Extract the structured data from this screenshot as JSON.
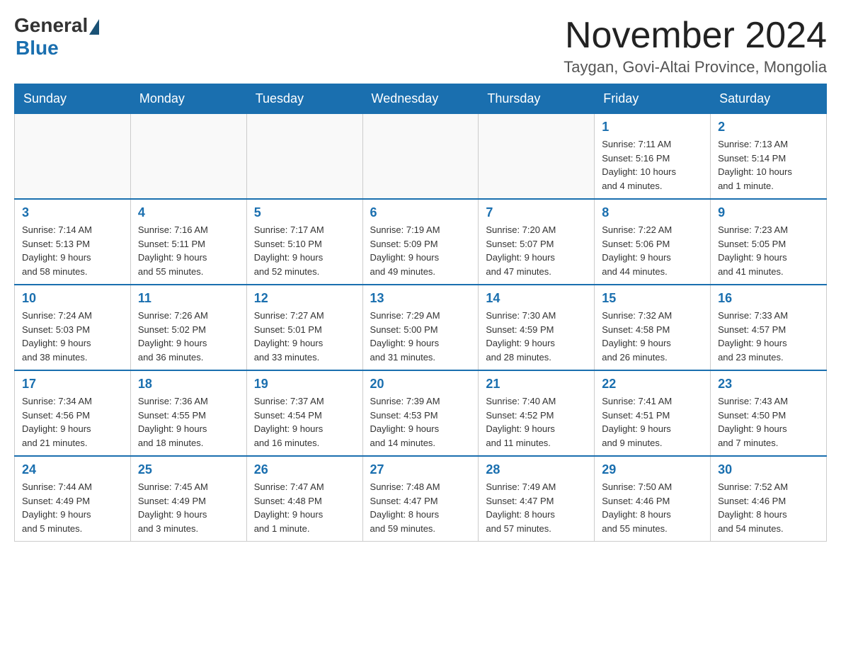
{
  "header": {
    "logo_general": "General",
    "logo_blue": "Blue",
    "month_title": "November 2024",
    "location": "Taygan, Govi-Altai Province, Mongolia"
  },
  "weekdays": [
    "Sunday",
    "Monday",
    "Tuesday",
    "Wednesday",
    "Thursday",
    "Friday",
    "Saturday"
  ],
  "weeks": [
    [
      {
        "day": "",
        "info": ""
      },
      {
        "day": "",
        "info": ""
      },
      {
        "day": "",
        "info": ""
      },
      {
        "day": "",
        "info": ""
      },
      {
        "day": "",
        "info": ""
      },
      {
        "day": "1",
        "info": "Sunrise: 7:11 AM\nSunset: 5:16 PM\nDaylight: 10 hours\nand 4 minutes."
      },
      {
        "day": "2",
        "info": "Sunrise: 7:13 AM\nSunset: 5:14 PM\nDaylight: 10 hours\nand 1 minute."
      }
    ],
    [
      {
        "day": "3",
        "info": "Sunrise: 7:14 AM\nSunset: 5:13 PM\nDaylight: 9 hours\nand 58 minutes."
      },
      {
        "day": "4",
        "info": "Sunrise: 7:16 AM\nSunset: 5:11 PM\nDaylight: 9 hours\nand 55 minutes."
      },
      {
        "day": "5",
        "info": "Sunrise: 7:17 AM\nSunset: 5:10 PM\nDaylight: 9 hours\nand 52 minutes."
      },
      {
        "day": "6",
        "info": "Sunrise: 7:19 AM\nSunset: 5:09 PM\nDaylight: 9 hours\nand 49 minutes."
      },
      {
        "day": "7",
        "info": "Sunrise: 7:20 AM\nSunset: 5:07 PM\nDaylight: 9 hours\nand 47 minutes."
      },
      {
        "day": "8",
        "info": "Sunrise: 7:22 AM\nSunset: 5:06 PM\nDaylight: 9 hours\nand 44 minutes."
      },
      {
        "day": "9",
        "info": "Sunrise: 7:23 AM\nSunset: 5:05 PM\nDaylight: 9 hours\nand 41 minutes."
      }
    ],
    [
      {
        "day": "10",
        "info": "Sunrise: 7:24 AM\nSunset: 5:03 PM\nDaylight: 9 hours\nand 38 minutes."
      },
      {
        "day": "11",
        "info": "Sunrise: 7:26 AM\nSunset: 5:02 PM\nDaylight: 9 hours\nand 36 minutes."
      },
      {
        "day": "12",
        "info": "Sunrise: 7:27 AM\nSunset: 5:01 PM\nDaylight: 9 hours\nand 33 minutes."
      },
      {
        "day": "13",
        "info": "Sunrise: 7:29 AM\nSunset: 5:00 PM\nDaylight: 9 hours\nand 31 minutes."
      },
      {
        "day": "14",
        "info": "Sunrise: 7:30 AM\nSunset: 4:59 PM\nDaylight: 9 hours\nand 28 minutes."
      },
      {
        "day": "15",
        "info": "Sunrise: 7:32 AM\nSunset: 4:58 PM\nDaylight: 9 hours\nand 26 minutes."
      },
      {
        "day": "16",
        "info": "Sunrise: 7:33 AM\nSunset: 4:57 PM\nDaylight: 9 hours\nand 23 minutes."
      }
    ],
    [
      {
        "day": "17",
        "info": "Sunrise: 7:34 AM\nSunset: 4:56 PM\nDaylight: 9 hours\nand 21 minutes."
      },
      {
        "day": "18",
        "info": "Sunrise: 7:36 AM\nSunset: 4:55 PM\nDaylight: 9 hours\nand 18 minutes."
      },
      {
        "day": "19",
        "info": "Sunrise: 7:37 AM\nSunset: 4:54 PM\nDaylight: 9 hours\nand 16 minutes."
      },
      {
        "day": "20",
        "info": "Sunrise: 7:39 AM\nSunset: 4:53 PM\nDaylight: 9 hours\nand 14 minutes."
      },
      {
        "day": "21",
        "info": "Sunrise: 7:40 AM\nSunset: 4:52 PM\nDaylight: 9 hours\nand 11 minutes."
      },
      {
        "day": "22",
        "info": "Sunrise: 7:41 AM\nSunset: 4:51 PM\nDaylight: 9 hours\nand 9 minutes."
      },
      {
        "day": "23",
        "info": "Sunrise: 7:43 AM\nSunset: 4:50 PM\nDaylight: 9 hours\nand 7 minutes."
      }
    ],
    [
      {
        "day": "24",
        "info": "Sunrise: 7:44 AM\nSunset: 4:49 PM\nDaylight: 9 hours\nand 5 minutes."
      },
      {
        "day": "25",
        "info": "Sunrise: 7:45 AM\nSunset: 4:49 PM\nDaylight: 9 hours\nand 3 minutes."
      },
      {
        "day": "26",
        "info": "Sunrise: 7:47 AM\nSunset: 4:48 PM\nDaylight: 9 hours\nand 1 minute."
      },
      {
        "day": "27",
        "info": "Sunrise: 7:48 AM\nSunset: 4:47 PM\nDaylight: 8 hours\nand 59 minutes."
      },
      {
        "day": "28",
        "info": "Sunrise: 7:49 AM\nSunset: 4:47 PM\nDaylight: 8 hours\nand 57 minutes."
      },
      {
        "day": "29",
        "info": "Sunrise: 7:50 AM\nSunset: 4:46 PM\nDaylight: 8 hours\nand 55 minutes."
      },
      {
        "day": "30",
        "info": "Sunrise: 7:52 AM\nSunset: 4:46 PM\nDaylight: 8 hours\nand 54 minutes."
      }
    ]
  ]
}
